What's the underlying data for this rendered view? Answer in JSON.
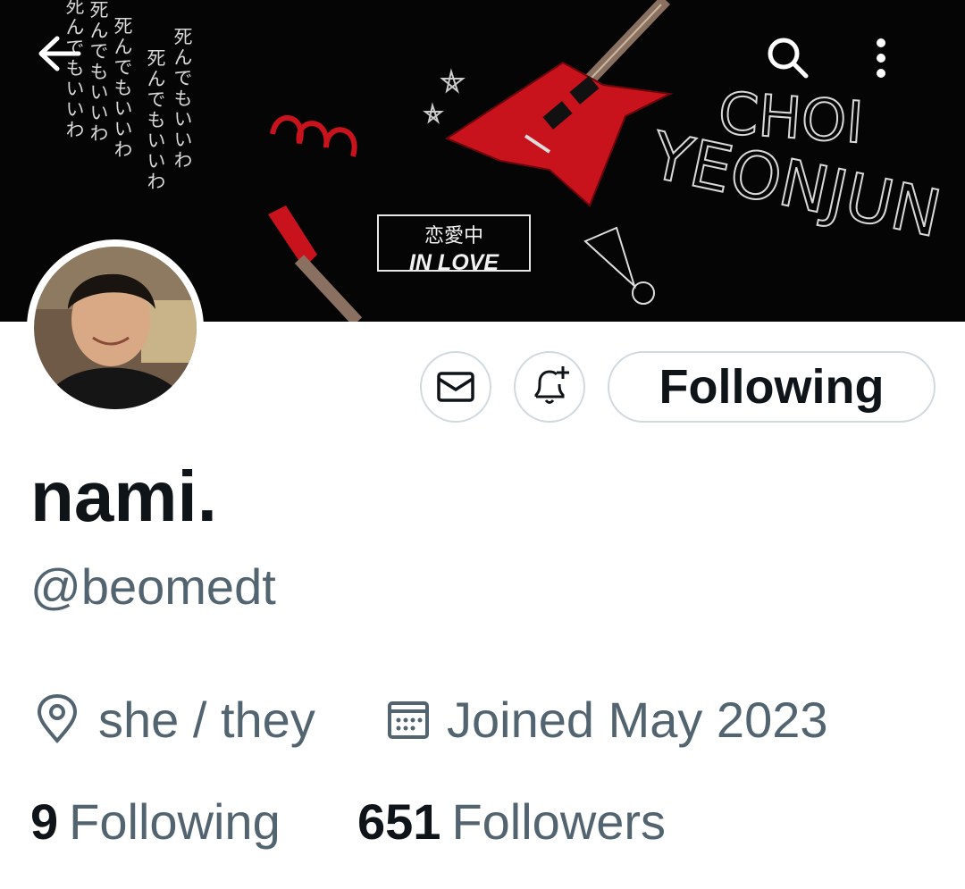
{
  "banner": {
    "jp_lines": [
      "死んでもいいわ",
      "死んでもいいわ",
      "死んでもいいわ",
      "死んでもいいわ",
      "死んでもいいわ"
    ],
    "inlove_jp": "恋愛中",
    "inlove_en": "IN LOVE",
    "artist_line1": "CHOI",
    "artist_line2": "YEONJUN"
  },
  "nav": {
    "back_icon": "back-arrow-icon",
    "search_icon": "search-icon",
    "more_icon": "more-vertical-icon"
  },
  "actions": {
    "message_icon": "envelope-icon",
    "notify_icon": "bell-plus-icon",
    "follow_label": "Following"
  },
  "profile": {
    "display_name": "nami.",
    "handle": "@beomedt",
    "location": "she / they",
    "joined": "Joined May 2023"
  },
  "stats": {
    "following_count": "9",
    "following_label": "Following",
    "followers_count": "651",
    "followers_label": "Followers"
  },
  "colors": {
    "text_primary": "#0f1419",
    "text_secondary": "#536471",
    "border": "#cfd9de",
    "guitar_red": "#c8121c"
  }
}
